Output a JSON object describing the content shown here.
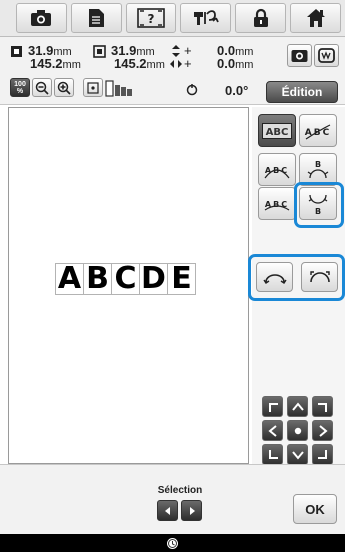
{
  "toolbar": {
    "buttons": [
      {
        "name": "camera-icon"
      },
      {
        "name": "page-icon"
      },
      {
        "name": "help-icon"
      },
      {
        "name": "needle-thread-icon"
      },
      {
        "name": "lock-icon"
      },
      {
        "name": "home-icon"
      }
    ]
  },
  "info": {
    "size_width": "31.9",
    "size_height": "145.2",
    "size_width_2": "31.9",
    "size_height_2": "145.2",
    "offset_v": "0.0",
    "offset_h": "0.0",
    "angle": "0.0°",
    "unit": "mm",
    "plus_sign": "+",
    "zoom_label": "100",
    "zoom_unit": "%",
    "edit_button": "Édition"
  },
  "pattern": {
    "letters": [
      "A",
      "B",
      "C",
      "D",
      "E"
    ]
  },
  "side_buttons": {
    "abc_straight": "ABC",
    "abc_small": "ABC",
    "abc_arc_up": "ABC",
    "abc_arc_small": "B",
    "abc_arc_down": "ABC",
    "abc_circle": "B"
  },
  "bottom": {
    "selection_label": "Sélection",
    "ok_label": "OK"
  },
  "colors": {
    "highlight": "#1a88d6",
    "selected_button": "#555555"
  }
}
